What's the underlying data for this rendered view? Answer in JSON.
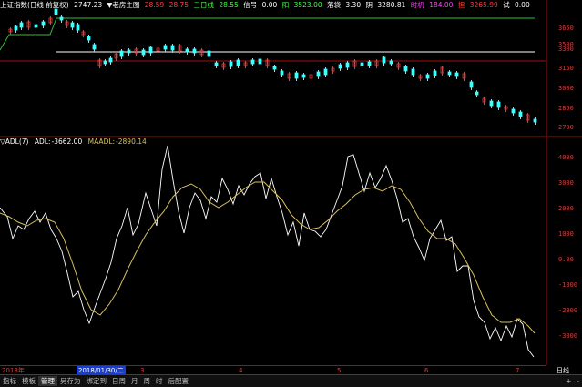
{
  "toolbar": {
    "title": "上证指数(日线 前复权)",
    "close": "2747.23",
    "indicator_name": "▼老房主图",
    "v1": "28.59",
    "v2": "28.75",
    "label_sanri": "三日线",
    "v3": "28.55",
    "label_xinhao": "信号",
    "v4": "0.00",
    "label_yang": "阳",
    "v5": "3523.00",
    "label_luodai": "落袋",
    "v6": "3.30",
    "label_yin": "阴",
    "v7": "3280.81",
    "label_shiji": "时机",
    "v8": "184.00",
    "label_dan": "担",
    "v9": "3265.99",
    "label_shi": "试",
    "v10": "0.00"
  },
  "adl": {
    "name": "▽ADL(7)",
    "adl_label": "ADL:",
    "adl_value": "-3662.00",
    "maadl_label": "MAADL:",
    "maadl_value": "-2890.14"
  },
  "price_axis": [
    "3650",
    "3500",
    "3300",
    "3150",
    "3000",
    "2850",
    "2700"
  ],
  "adl_axis": [
    "4000",
    "3000",
    "2000",
    "1000",
    "0.00",
    "-1000",
    "-2000",
    "-3000"
  ],
  "dates": {
    "year": "2018年",
    "selected": "2018/01/30/二",
    "m3": "3",
    "m4": "4",
    "m5": "5",
    "m6": "6",
    "m7": "7"
  },
  "right_tools": {
    "label": "日线"
  },
  "bottom_tabs": [
    "指标",
    "模板",
    "管理",
    "另存为",
    "绑定到",
    "日周",
    "月",
    "周",
    "时",
    "后配置"
  ],
  "bottom_right": [
    "+",
    "-"
  ],
  "colors": {
    "up": "#ff3030",
    "down": "#40ffff",
    "adl": "#ffffff",
    "maadl": "#d8c060",
    "grid": "#a01010"
  }
}
